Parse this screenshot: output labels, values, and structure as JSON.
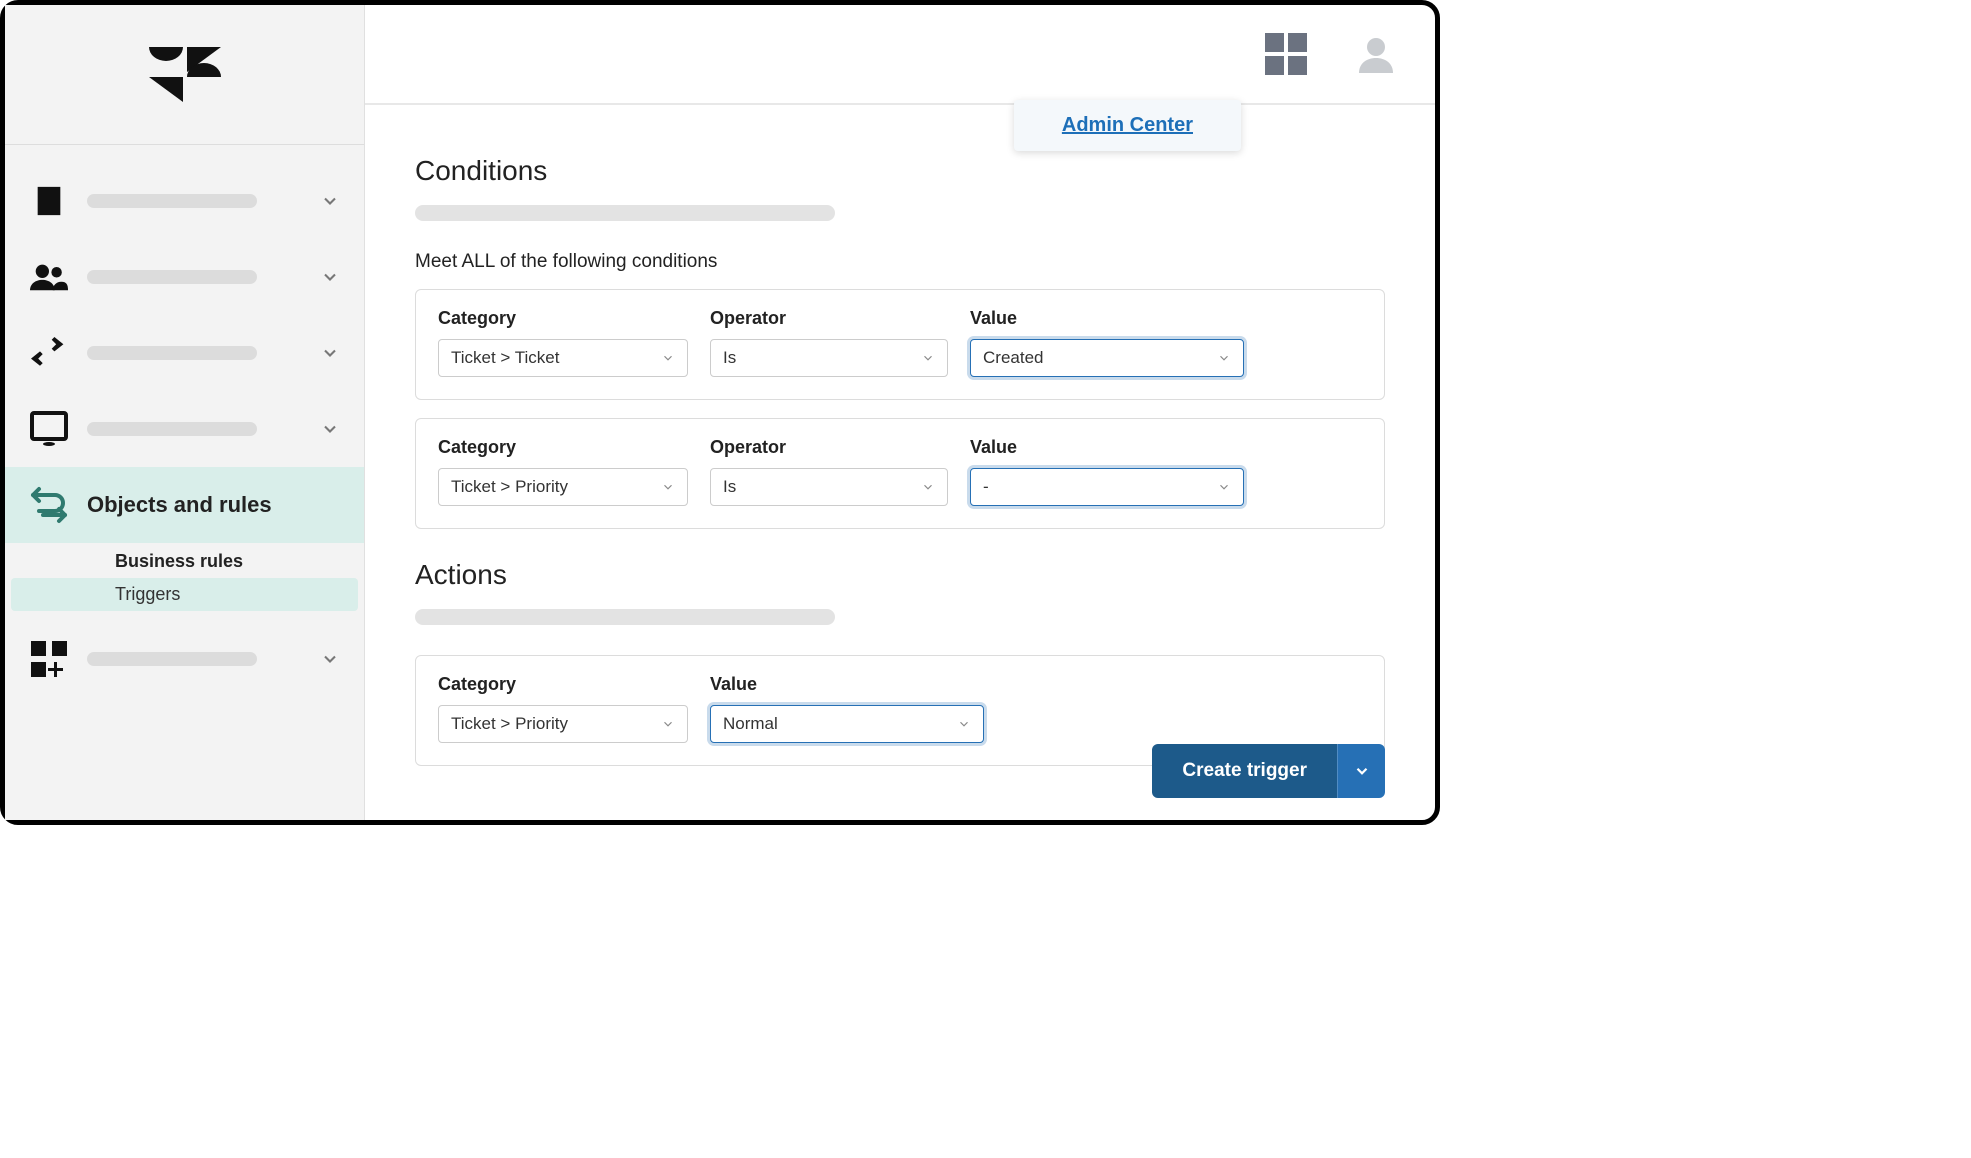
{
  "header": {
    "admin_center_label": "Admin Center"
  },
  "sidebar": {
    "active_label": "Objects and rules",
    "sub_heading": "Business rules",
    "sub_link": "Triggers"
  },
  "conditions": {
    "title": "Conditions",
    "all_label": "Meet ALL of the following conditions",
    "labels": {
      "category": "Category",
      "operator": "Operator",
      "value": "Value"
    },
    "rows": [
      {
        "category": "Ticket > Ticket",
        "operator": "Is",
        "value": "Created"
      },
      {
        "category": "Ticket > Priority",
        "operator": "Is",
        "value": "-"
      }
    ]
  },
  "actions": {
    "title": "Actions",
    "labels": {
      "category": "Category",
      "value": "Value"
    },
    "rows": [
      {
        "category": "Ticket > Priority",
        "value": "Normal"
      }
    ]
  },
  "footer": {
    "create_label": "Create trigger"
  }
}
